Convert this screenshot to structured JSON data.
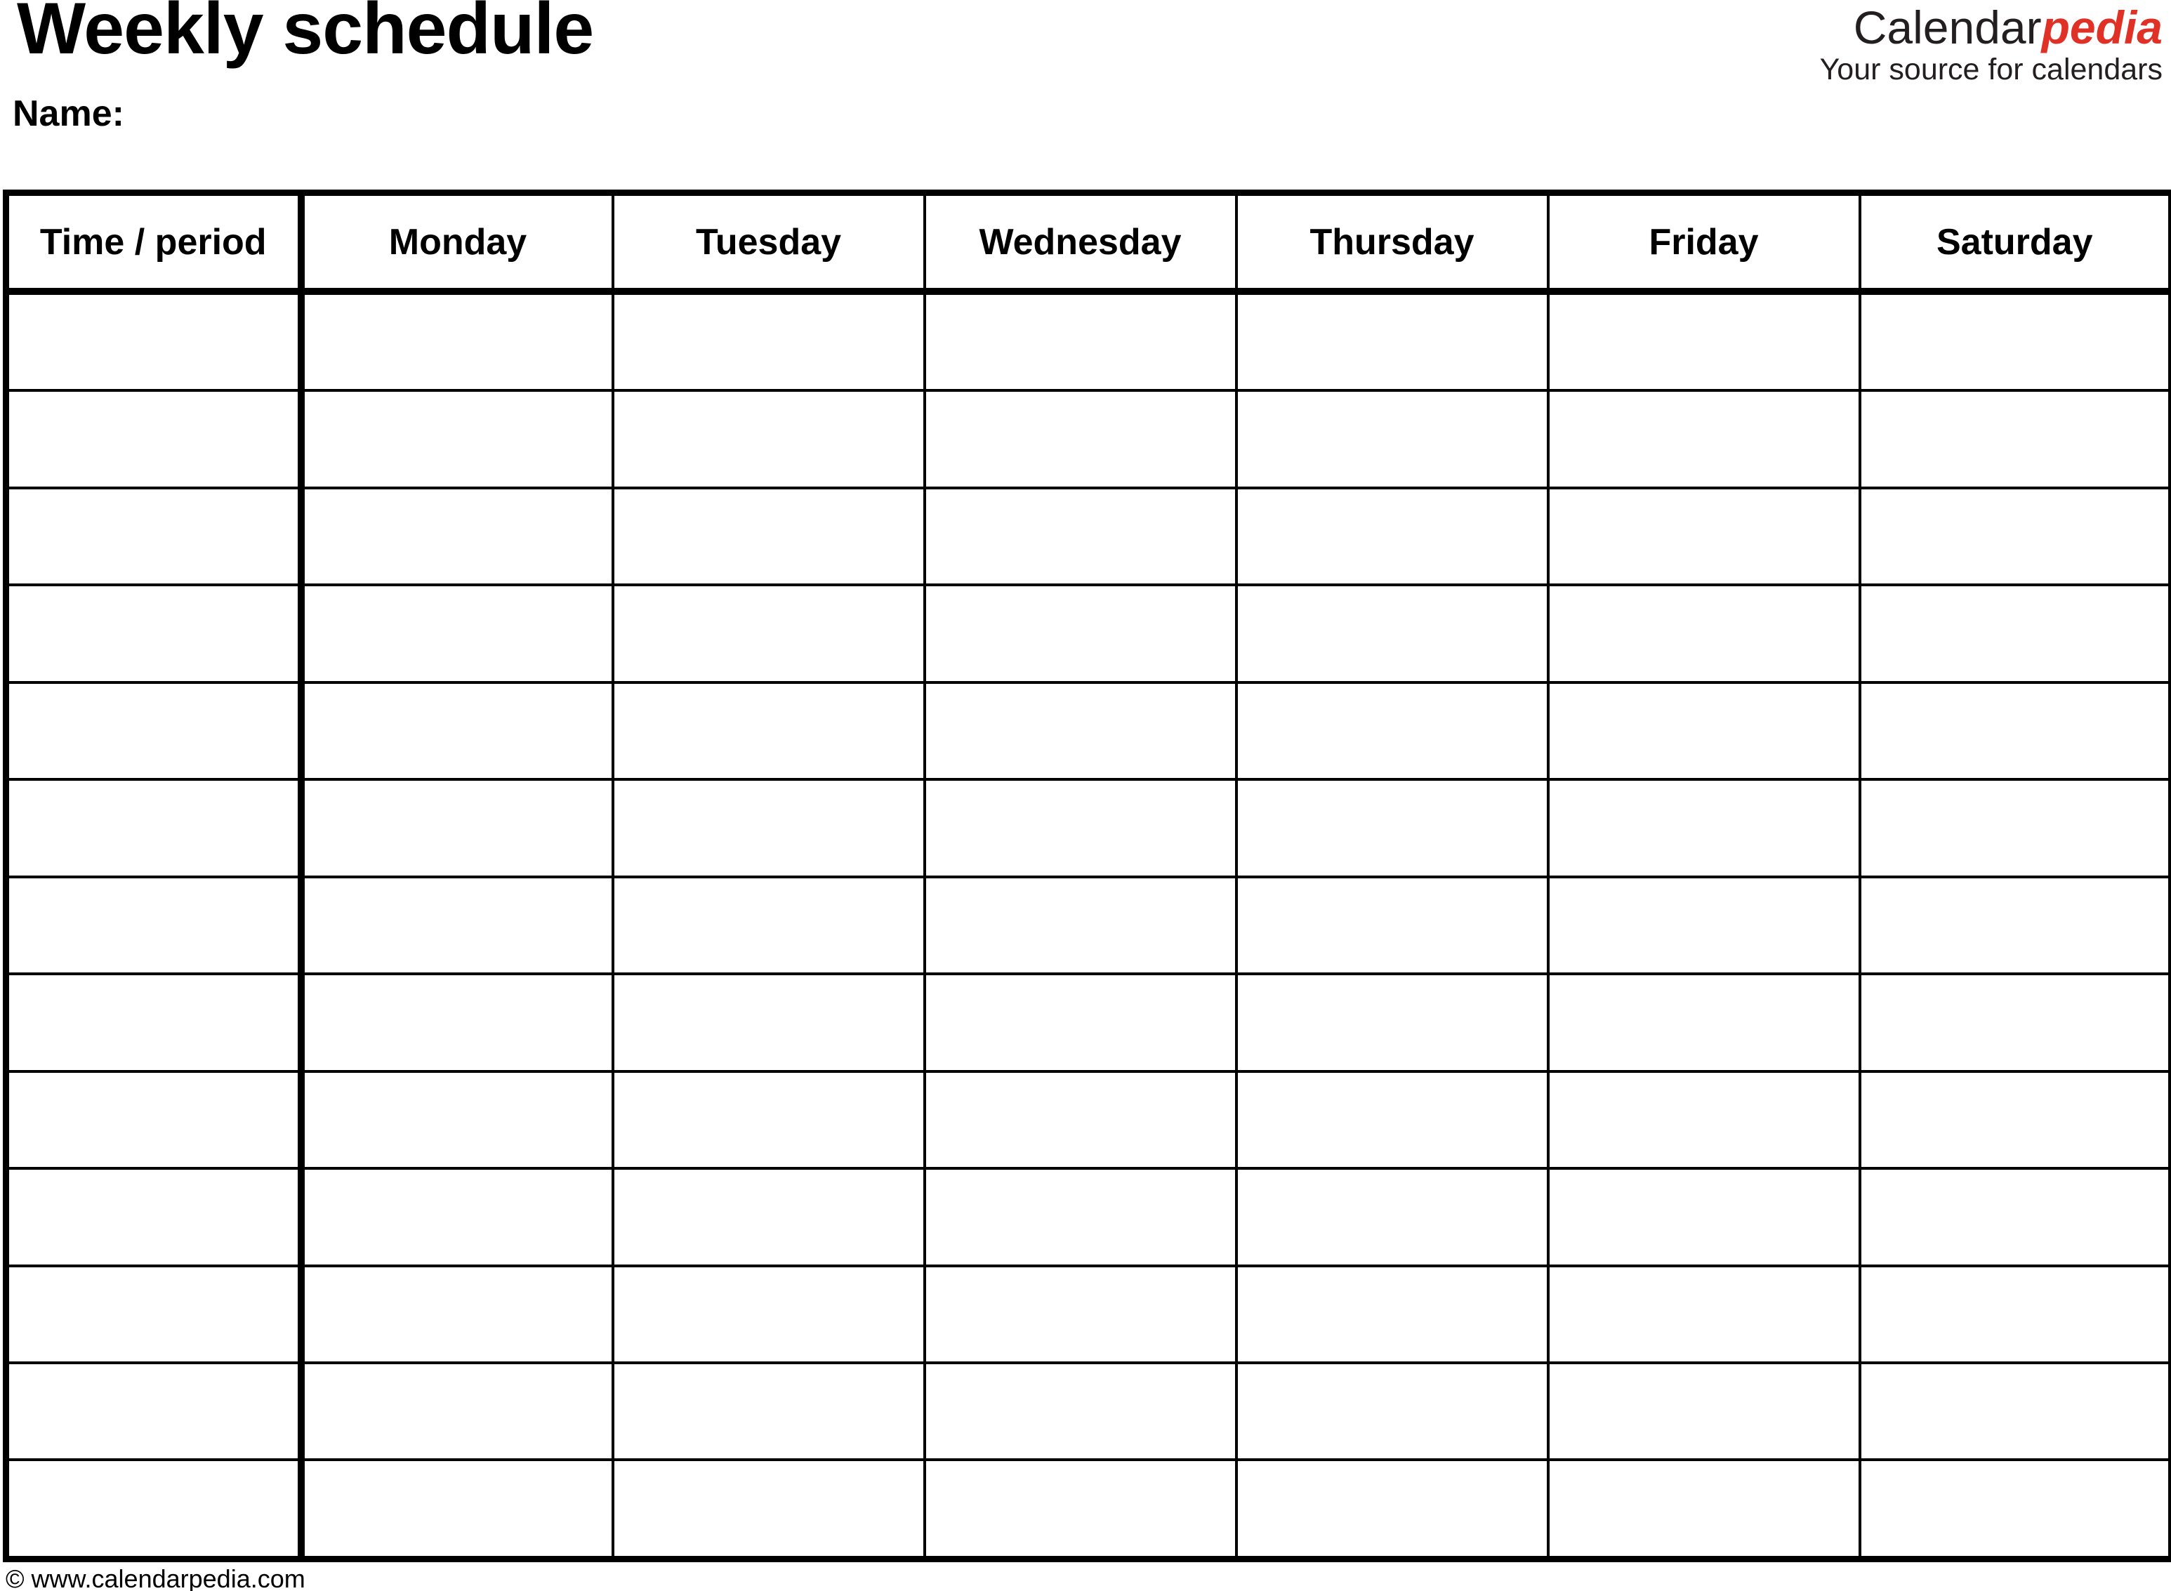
{
  "document": {
    "title": "Weekly schedule",
    "name_label": "Name:"
  },
  "brand": {
    "word_first": "Calendar",
    "word_second": "pedia",
    "tagline": "Your source for calendars",
    "accent_color": "#e03127",
    "text_color": "#231f20"
  },
  "table": {
    "columns": [
      "Time / period",
      "Monday",
      "Tuesday",
      "Wednesday",
      "Thursday",
      "Friday",
      "Saturday"
    ],
    "row_count": 13,
    "rows": [
      [
        "",
        "",
        "",
        "",
        "",
        "",
        ""
      ],
      [
        "",
        "",
        "",
        "",
        "",
        "",
        ""
      ],
      [
        "",
        "",
        "",
        "",
        "",
        "",
        ""
      ],
      [
        "",
        "",
        "",
        "",
        "",
        "",
        ""
      ],
      [
        "",
        "",
        "",
        "",
        "",
        "",
        ""
      ],
      [
        "",
        "",
        "",
        "",
        "",
        "",
        ""
      ],
      [
        "",
        "",
        "",
        "",
        "",
        "",
        ""
      ],
      [
        "",
        "",
        "",
        "",
        "",
        "",
        ""
      ],
      [
        "",
        "",
        "",
        "",
        "",
        "",
        ""
      ],
      [
        "",
        "",
        "",
        "",
        "",
        "",
        ""
      ],
      [
        "",
        "",
        "",
        "",
        "",
        "",
        ""
      ],
      [
        "",
        "",
        "",
        "",
        "",
        "",
        ""
      ],
      [
        "",
        "",
        "",
        "",
        "",
        "",
        ""
      ]
    ]
  },
  "footer": {
    "copyright": "© www.calendarpedia.com"
  }
}
